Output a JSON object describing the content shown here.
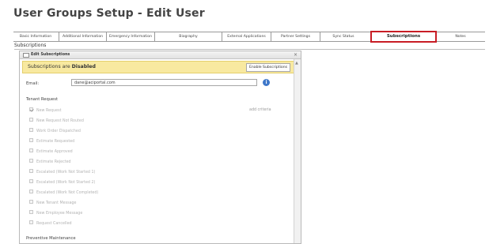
{
  "page": {
    "title": "User Groups Setup - Edit User"
  },
  "tabs": [
    {
      "label": "Basic Information"
    },
    {
      "label": "Additional Information"
    },
    {
      "label": "Emergency Information"
    },
    {
      "label": "Biography"
    },
    {
      "label": "External Applications"
    },
    {
      "label": "Partner Settings"
    },
    {
      "label": "Sync Status"
    },
    {
      "label": "Subscriptions",
      "active": true
    },
    {
      "label": "Notes"
    }
  ],
  "section": {
    "label": "Subscriptions"
  },
  "panel": {
    "title": "Edit Subscriptions",
    "close": "×",
    "banner": {
      "prefix": "Subscriptions are ",
      "status": "Disabled",
      "button": "Enable Subscriptions"
    },
    "email": {
      "label": "Email:",
      "value": "dane@aciportal.com",
      "info_icon": "i"
    },
    "tenant_request": {
      "label": "Tenant Request",
      "add_criteria": "add criteria",
      "items": [
        {
          "label": "New Request",
          "checked": true
        },
        {
          "label": "New Request Not Routed",
          "checked": false
        },
        {
          "label": "Work Order Dispatched",
          "checked": false
        },
        {
          "label": "Estimate Requested",
          "checked": false
        },
        {
          "label": "Estimate Approved",
          "checked": false
        },
        {
          "label": "Estimate Rejected",
          "checked": false
        },
        {
          "label": "Escalated (Work Not Started 1)",
          "checked": false
        },
        {
          "label": "Escalated (Work Not Started 2)",
          "checked": false
        },
        {
          "label": "Escalated (Work Not Completed)",
          "checked": false
        },
        {
          "label": "New Tenant Message",
          "checked": false
        },
        {
          "label": "New Employee Message",
          "checked": false
        },
        {
          "label": "Request Cancelled",
          "checked": false
        }
      ]
    },
    "preventive_maintenance": {
      "label": "Preventive Maintenance"
    }
  },
  "colors": {
    "active_tab_border": "#c81d25",
    "banner_bg": "#f8e9a0",
    "info_icon": "#3e77c9"
  }
}
